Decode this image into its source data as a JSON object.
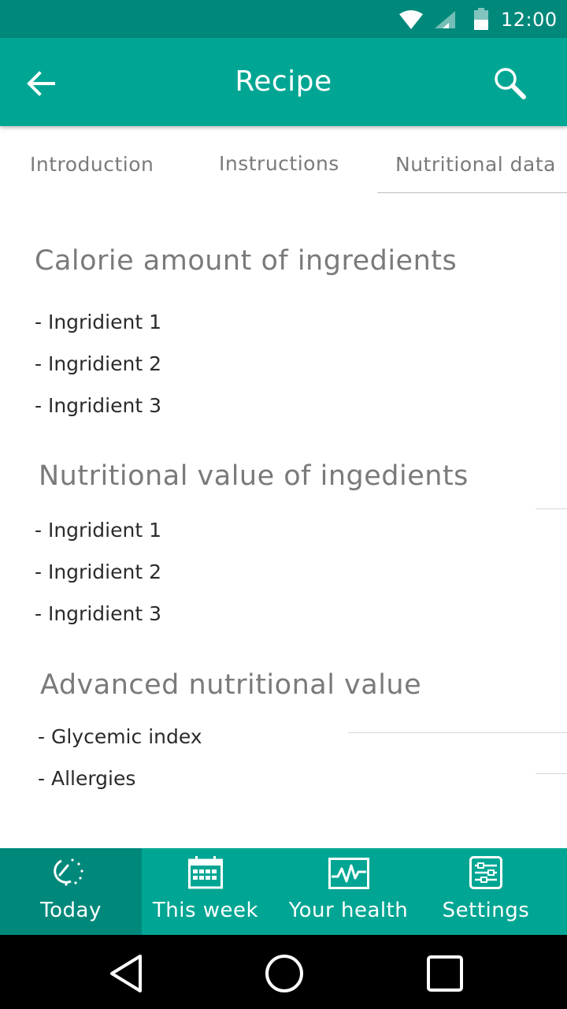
{
  "status_bar": {
    "time": "12:00",
    "icons": [
      "wifi-icon",
      "signal-icon",
      "battery-icon"
    ]
  },
  "app_bar": {
    "title": "Recipe",
    "back_icon": "arrow-left-icon",
    "search_icon": "search-icon"
  },
  "tabs": [
    {
      "label": "Introduction",
      "selected": false
    },
    {
      "label": "Instructions",
      "selected": false
    },
    {
      "label": "Nutritional data",
      "selected": true
    }
  ],
  "sections": [
    {
      "title": "Calorie amount of ingredients",
      "items": [
        "- Ingridient 1",
        "- Ingridient 2",
        "- Ingridient 3"
      ]
    },
    {
      "title": "Nutritional value of ingedients",
      "items": [
        "- Ingridient 1",
        "- Ingridient 2",
        "- Ingridient 3"
      ]
    },
    {
      "title": "Advanced nutritional value",
      "items": [
        "- Glycemic index",
        "- Allergies"
      ]
    }
  ],
  "bottom_nav": [
    {
      "label": "Today",
      "icon": "clock-icon",
      "active": true
    },
    {
      "label": "This week",
      "icon": "calendar-icon",
      "active": false
    },
    {
      "label": "Your health",
      "icon": "heart-rate-icon",
      "active": false
    },
    {
      "label": "Settings",
      "icon": "sliders-icon",
      "active": false
    }
  ],
  "system_nav": {
    "icons": [
      "back-triangle-icon",
      "home-circle-icon",
      "recents-square-icon"
    ]
  },
  "colors": {
    "primary": "#00a693",
    "primary_dark": "#00897b",
    "text_secondary": "#7a7a7a",
    "text_primary": "#2b2b2b"
  }
}
